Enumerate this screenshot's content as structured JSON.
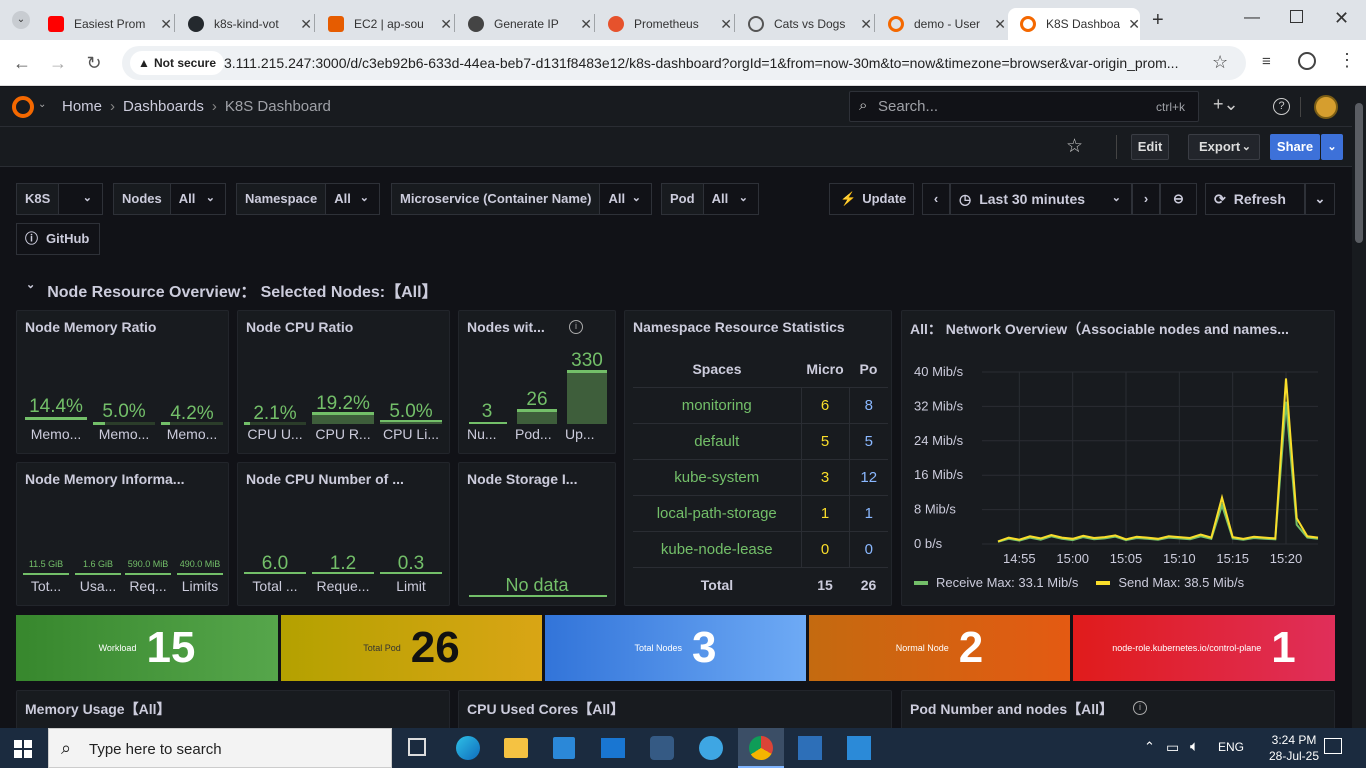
{
  "browser": {
    "tabs": [
      {
        "title": "Easiest Prom",
        "icon": "youtube-icon",
        "color": "#ff0000"
      },
      {
        "title": "k8s-kind-vot",
        "icon": "github-icon",
        "color": "#24292e"
      },
      {
        "title": "EC2 | ap-sou",
        "icon": "aws-icon",
        "color": "#e65c00"
      },
      {
        "title": "Generate IP",
        "icon": "openai-icon",
        "color": "#444444"
      },
      {
        "title": "Prometheus",
        "icon": "prometheus-icon",
        "color": "#e6522c"
      },
      {
        "title": "Cats vs Dogs",
        "icon": "globe-icon",
        "color": "#555555"
      },
      {
        "title": "demo - User",
        "icon": "grafana-icon",
        "color": "#f46800"
      },
      {
        "title": "K8S Dashboa",
        "icon": "grafana-icon",
        "color": "#f46800"
      }
    ],
    "not_secure": "Not secure",
    "url": "3.111.215.247:3000/d/c3eb92b6-633d-44ea-beb7-d131f8483e12/k8s-dashboard?orgId=1&from=now-30m&to=now&timezone=browser&var-origin_prom..."
  },
  "grafana": {
    "breadcrumb": [
      "Home",
      "Dashboards",
      "K8S Dashboard"
    ],
    "search_placeholder": "Search...",
    "search_shortcut": "ctrl+k",
    "edit": "Edit",
    "export": "Export",
    "share": "Share",
    "variables": [
      {
        "label": "K8S",
        "value": ""
      },
      {
        "label": "Nodes",
        "value": "All"
      },
      {
        "label": "Namespace",
        "value": "All"
      },
      {
        "label": "Microservice (Container Name)",
        "value": "All"
      },
      {
        "label": "Pod",
        "value": "All"
      }
    ],
    "update": "Update",
    "time_range": "Last 30 minutes",
    "refresh": "Refresh",
    "github": "GitHub",
    "row_title": "Node Resource Overview： Selected Nodes:【All】"
  },
  "panels": {
    "mem_ratio": {
      "title": "Node Memory Ratio",
      "gauges": [
        {
          "v": "14.4%",
          "l": "Memo...",
          "f": 0.144
        },
        {
          "v": "5.0%",
          "l": "Memo...",
          "f": 0.05
        },
        {
          "v": "4.2%",
          "l": "Memo...",
          "f": 0.042
        }
      ]
    },
    "cpu_ratio": {
      "title": "Node CPU Ratio",
      "gauges": [
        {
          "v": "2.1%",
          "l": "CPU U...",
          "f": 0.021
        },
        {
          "v": "19.2%",
          "l": "CPU R...",
          "f": 0.192
        },
        {
          "v": "5.0%",
          "l": "CPU Li...",
          "f": 0.05
        }
      ]
    },
    "nodes_with": {
      "title": "Nodes wit...",
      "bars": [
        {
          "v": "3",
          "l": "Nu..."
        },
        {
          "v": "26",
          "l": "Pod..."
        },
        {
          "v": "330",
          "l": "Up..."
        }
      ]
    },
    "mem_info": {
      "title": "Node Memory Informa...",
      "gauges": [
        {
          "v": "11.5 GiB",
          "l": "Tot..."
        },
        {
          "v": "1.6 GiB",
          "l": "Usa..."
        },
        {
          "v": "590.0 MiB",
          "l": "Req..."
        },
        {
          "v": "490.0 MiB",
          "l": "Limits"
        }
      ]
    },
    "cpu_num": {
      "title": "Node CPU Number of ...",
      "gauges": [
        {
          "v": "6.0",
          "l": "Total ..."
        },
        {
          "v": "1.2",
          "l": "Reque..."
        },
        {
          "v": "0.3",
          "l": "Limit"
        }
      ]
    },
    "storage": {
      "title": "Node Storage I...",
      "nodata": "No data"
    },
    "ns_stats": {
      "title": "Namespace Resource Statistics",
      "headers": [
        "Spaces",
        "Micro",
        "Po"
      ],
      "rows": [
        {
          "space": "monitoring",
          "micro": "6",
          "pods": "8"
        },
        {
          "space": "default",
          "micro": "5",
          "pods": "5"
        },
        {
          "space": "kube-system",
          "micro": "3",
          "pods": "12"
        },
        {
          "space": "local-path-storage",
          "micro": "1",
          "pods": "1"
        },
        {
          "space": "kube-node-lease",
          "micro": "0",
          "pods": "0"
        }
      ],
      "total_label": "Total",
      "total_micro": "15",
      "total_pods": "26"
    },
    "network": {
      "title": "All： Network Overview（Associable nodes and names..."
    },
    "stats": [
      {
        "label": "Workload",
        "value": "15"
      },
      {
        "label": "Total Pod",
        "value": "26"
      },
      {
        "label": "Total Nodes",
        "value": "3"
      },
      {
        "label": "Normal Node",
        "value": "2"
      },
      {
        "label": "node-role.kubernetes.io/control-plane",
        "value": "1"
      }
    ],
    "bottom": [
      "Memory Usage【All】",
      "CPU Used Cores【All】",
      "Pod Number and nodes【All】"
    ]
  },
  "chart_data": {
    "type": "line",
    "title": "All： Network Overview（Associable nodes and names...",
    "x": [
      "14:53",
      "14:54",
      "14:55",
      "14:56",
      "14:57",
      "14:58",
      "14:59",
      "15:00",
      "15:01",
      "15:02",
      "15:03",
      "15:04",
      "15:05",
      "15:06",
      "15:07",
      "15:08",
      "15:09",
      "15:10",
      "15:11",
      "15:12",
      "15:13",
      "15:14",
      "15:15",
      "15:16",
      "15:17",
      "15:18",
      "15:19",
      "15:20",
      "15:21",
      "15:22",
      "15:23"
    ],
    "xticks": [
      "14:55",
      "15:00",
      "15:05",
      "15:10",
      "15:15",
      "15:20"
    ],
    "yticks": [
      "0 b/s",
      "8 Mib/s",
      "16 Mib/s",
      "24 Mib/s",
      "32 Mib/s",
      "40 Mib/s"
    ],
    "ylim": [
      0,
      40
    ],
    "series": [
      {
        "name": "Receive",
        "color": "#73bf69",
        "legend": "Receive  Max: 33.1 Mib/s",
        "values": [
          0.5,
          1.2,
          0.8,
          1.5,
          1.0,
          1.8,
          1.2,
          0.9,
          1.6,
          1.1,
          1.3,
          1.7,
          0.9,
          1.4,
          1.2,
          1.0,
          1.5,
          1.3,
          1.1,
          1.8,
          1.2,
          9.0,
          1.3,
          1.0,
          1.4,
          1.2,
          1.1,
          33.1,
          4.5,
          1.5,
          1.2
        ]
      },
      {
        "name": "Send",
        "color": "#fade2a",
        "legend": "Send  Max: 38.5 Mib/s",
        "values": [
          0.6,
          1.5,
          1.0,
          1.8,
          1.3,
          2.1,
          1.5,
          1.2,
          1.9,
          1.4,
          1.6,
          2.0,
          1.1,
          1.7,
          1.5,
          1.2,
          1.8,
          1.6,
          1.4,
          2.2,
          1.5,
          10.8,
          1.6,
          1.2,
          1.7,
          1.5,
          1.3,
          38.5,
          6.0,
          1.8,
          1.5
        ]
      }
    ]
  },
  "taskbar": {
    "search": "Type here to search",
    "lang": "ENG",
    "time": "3:24 PM",
    "date": "28-Jul-25"
  }
}
